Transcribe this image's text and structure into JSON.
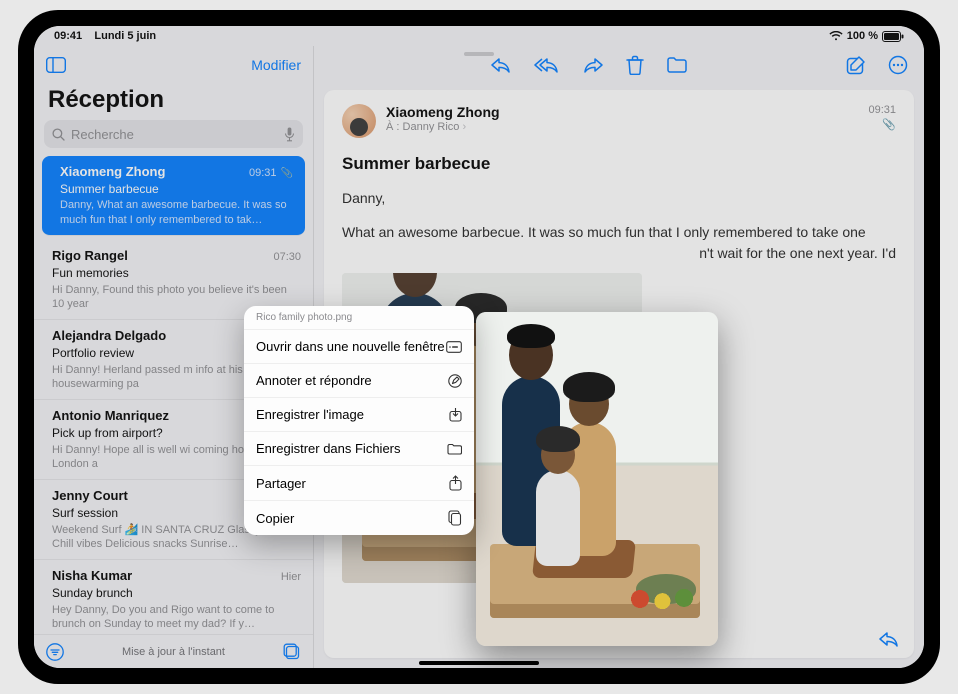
{
  "statusbar": {
    "time": "09:41",
    "date": "Lundi 5 juin",
    "battery": "100 %"
  },
  "sidebar": {
    "edit": "Modifier",
    "title": "Réception",
    "search_placeholder": "Recherche",
    "footer_status": "Mise à jour à l'instant"
  },
  "messages": [
    {
      "sender": "Xiaomeng Zhong",
      "time": "09:31",
      "subject": "Summer barbecue",
      "preview": "Danny, What an awesome barbecue. It was so much fun that I only remembered to tak…",
      "selected": true,
      "attachment": true
    },
    {
      "sender": "Rigo Rangel",
      "time": "07:30",
      "subject": "Fun memories",
      "preview": "Hi Danny, Found this photo you believe it's been 10 year"
    },
    {
      "sender": "Alejandra Delgado",
      "time": "",
      "subject": "Portfolio review",
      "preview": "Hi Danny! Herland passed m info at his housewarming pa"
    },
    {
      "sender": "Antonio Manriquez",
      "time": "",
      "subject": "Pick up from airport?",
      "preview": "Hi Danny! Hope all is well wi coming home from London a"
    },
    {
      "sender": "Jenny Court",
      "time": "",
      "subject": "Surf session",
      "preview": "Weekend Surf 🏄 IN SANTA CRUZ Glassy waves Chill vibes Delicious snacks Sunrise…"
    },
    {
      "sender": "Nisha Kumar",
      "time": "Hier",
      "subject": "Sunday brunch",
      "preview": "Hey Danny, Do you and Rigo want to come to brunch on Sunday to meet my dad? If y…"
    }
  ],
  "mail": {
    "from": "Xiaomeng Zhong",
    "to_label": "À :",
    "to_name": "Danny Rico",
    "time": "09:31",
    "subject": "Summer barbecue",
    "greeting": "Danny,",
    "body": "What an awesome barbecue. It was so much fun that I only remembered to take one",
    "body2_visible": "n't wait for the one next year. I'd"
  },
  "popover": {
    "filename": "Rico family photo.png",
    "items": [
      {
        "label": "Ouvrir dans une nouvelle fenêtre",
        "icon": "window-icon"
      },
      {
        "label": "Annoter et répondre",
        "icon": "markup-icon"
      },
      {
        "label": "Enregistrer l'image",
        "icon": "save-down-icon"
      },
      {
        "label": "Enregistrer dans Fichiers",
        "icon": "folder-icon"
      },
      {
        "label": "Partager",
        "icon": "share-icon"
      },
      {
        "label": "Copier",
        "icon": "copy-icon"
      }
    ]
  }
}
